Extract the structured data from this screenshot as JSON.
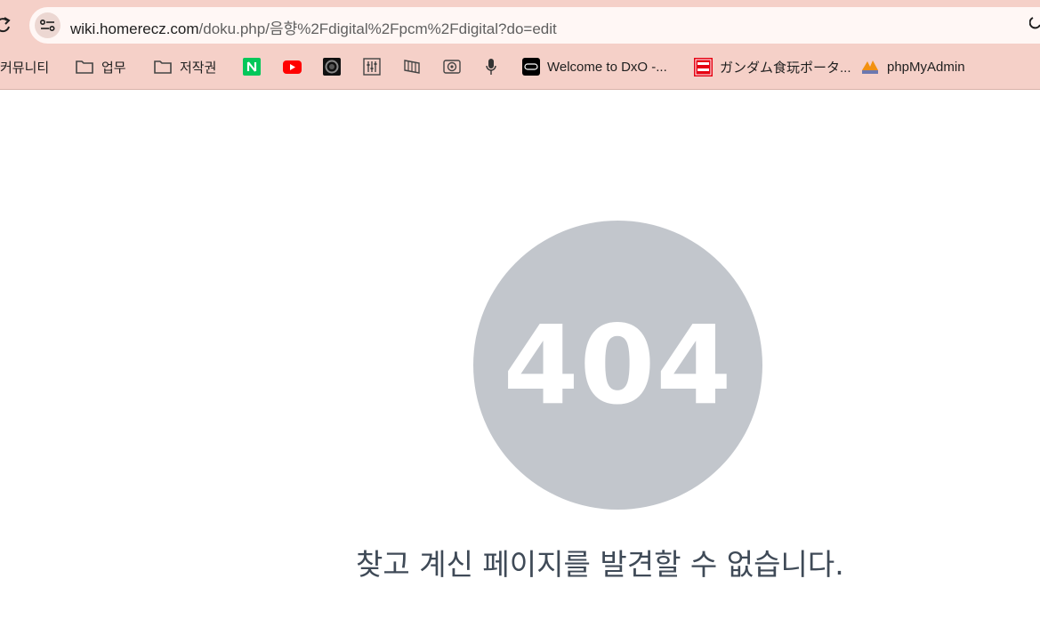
{
  "browser": {
    "url_host": "wiki.homerecz.com",
    "url_rest": "/doku.php/음향%2Fdigital%2Fpcm%2Fdigital?do=edit"
  },
  "bookmarks": [
    {
      "label": "커뮤니티",
      "icon": "none"
    },
    {
      "label": "업무",
      "icon": "folder-icon"
    },
    {
      "label": "저작권",
      "icon": "folder-icon"
    },
    {
      "label": "",
      "icon": "naver-icon"
    },
    {
      "label": "",
      "icon": "youtube-icon"
    },
    {
      "label": "",
      "icon": "dark-circle-icon"
    },
    {
      "label": "",
      "icon": "mixer-icon"
    },
    {
      "label": "",
      "icon": "waveform-icon"
    },
    {
      "label": "",
      "icon": "speaker-icon"
    },
    {
      "label": "",
      "icon": "microphone-icon"
    },
    {
      "label": "Welcome to DxO -...",
      "icon": "dxo-icon"
    },
    {
      "label": "ガンダム食玩ポータ...",
      "icon": "bandai-icon"
    },
    {
      "label": "phpMyAdmin",
      "icon": "pma-icon"
    }
  ],
  "error": {
    "code": "404",
    "message": "찾고 계신 페이지를 발견할 수 없습니다."
  },
  "colors": {
    "chrome_bg": "#f5d0c8",
    "circle": "#c2c6cc",
    "message_text": "#3f4a57"
  }
}
